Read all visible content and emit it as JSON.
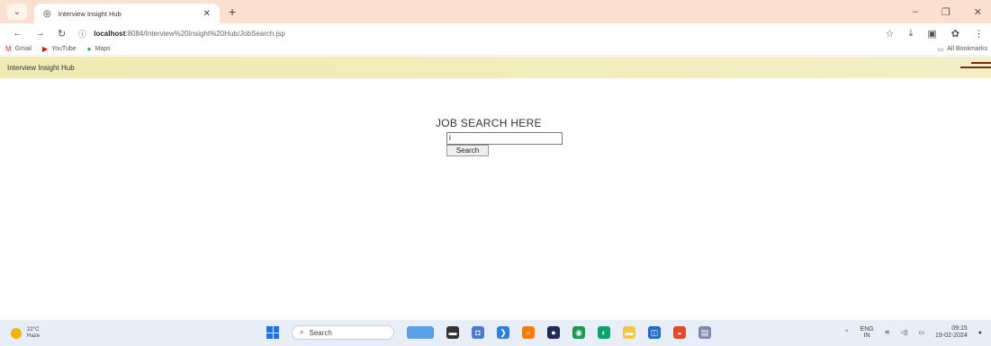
{
  "browser": {
    "tab_title": "Interview Insight Hub",
    "url_host": "localhost",
    "url_path": ":8084/Interview%20Insight%20Hub/JobSearch.jsp",
    "bookmarks": [
      "Gmail",
      "YouTube",
      "Maps"
    ],
    "all_bookmarks": "All Bookmarks"
  },
  "page": {
    "brand": "Interview Insight Hub",
    "heading": "JOB SEARCH HERE",
    "search_value": "i",
    "search_button": "Search"
  },
  "taskbar": {
    "temperature": "22°C",
    "weather": "Haze",
    "search_placeholder": "Search",
    "lang": "ENG",
    "region": "IN",
    "time": "09:15",
    "date": "19-02-2024"
  }
}
